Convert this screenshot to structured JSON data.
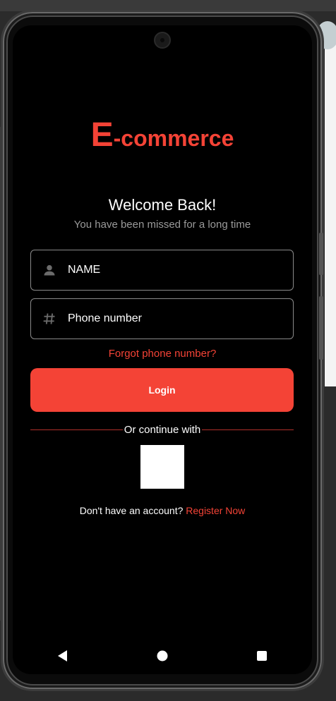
{
  "app": {
    "logo_letter": "E",
    "logo_rest": "-commerce",
    "accent_color": "#f44336"
  },
  "welcome": {
    "title": "Welcome Back!",
    "subtitle": "You have been missed for a long time"
  },
  "form": {
    "name_placeholder": "NAME",
    "phone_placeholder": "Phone number",
    "forgot_label": "Forgot phone number?",
    "login_label": "Login"
  },
  "social": {
    "divider_label": "Or continue with"
  },
  "register": {
    "prompt": "Don't have an account?",
    "link_label": "Register Now"
  },
  "nav": {
    "icons": [
      "back-icon",
      "home-icon",
      "recents-icon"
    ]
  }
}
